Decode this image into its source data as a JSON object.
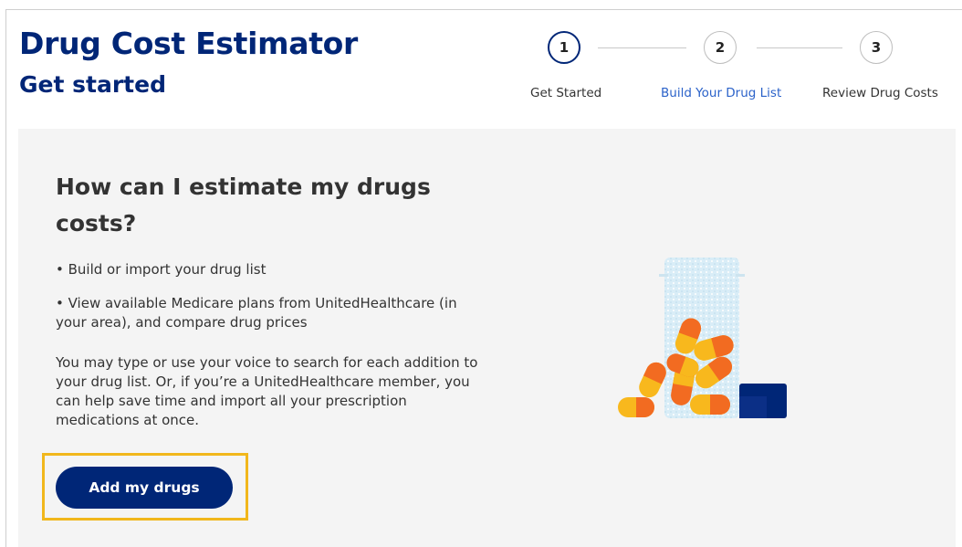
{
  "header": {
    "title": "Drug Cost Estimator",
    "subtitle": "Get started"
  },
  "stepper": {
    "steps": [
      {
        "number": "1",
        "label": "Get Started",
        "state": "active"
      },
      {
        "number": "2",
        "label": "Build Your Drug List",
        "state": "link"
      },
      {
        "number": "3",
        "label": "Review Drug Costs",
        "state": "inactive"
      }
    ]
  },
  "main": {
    "heading": "How can I estimate my drugs costs?",
    "bullets": [
      "• Build or import your drug list",
      "• View available Medicare plans from UnitedHealthcare (in your area), and compare drug prices"
    ],
    "paragraph": "You may type or use your voice to search for each addition to your drug list. Or, if you’re a UnitedHealthcare member, you can help save time and import all your prescription medications at once.",
    "add_button_label": "Add my drugs"
  },
  "illustration": {
    "name": "pill-bottle-illustration",
    "colors": {
      "bottle": "#cfe6f2",
      "pill_orange": "#f26b21",
      "pill_yellow": "#f8b81d",
      "cap": "#002677"
    }
  },
  "colors": {
    "brand_navy": "#002677",
    "link_blue": "#2b62c9",
    "panel_bg": "#f4f4f4",
    "focus_highlight": "#f1b71c"
  }
}
